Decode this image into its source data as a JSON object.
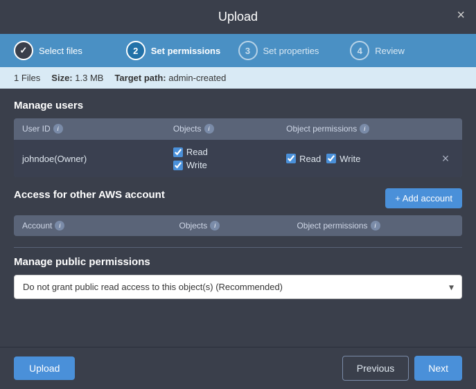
{
  "modal": {
    "title": "Upload",
    "close_label": "×"
  },
  "steps": [
    {
      "id": 1,
      "label": "Select files",
      "state": "completed",
      "icon": "✓"
    },
    {
      "id": 2,
      "label": "Set permissions",
      "state": "active"
    },
    {
      "id": 3,
      "label": "Set properties",
      "state": "inactive"
    },
    {
      "id": 4,
      "label": "Review",
      "state": "inactive"
    }
  ],
  "info_bar": {
    "files_label": "1 Files",
    "size_label": "Size:",
    "size_value": "1.3 MB",
    "target_label": "Target path:",
    "target_value": "admin-created"
  },
  "manage_users": {
    "title": "Manage users",
    "columns": {
      "user_id": "User ID",
      "objects": "Objects",
      "object_permissions": "Object permissions"
    },
    "rows": [
      {
        "user_id": "johndoe(Owner)",
        "objects": [
          "Read",
          "Write"
        ],
        "obj_permissions": [
          "Read",
          "Write"
        ]
      }
    ]
  },
  "aws_section": {
    "title": "Access for other AWS account",
    "add_btn": "+ Add account",
    "columns": {
      "account": "Account",
      "objects": "Objects",
      "object_permissions": "Object permissions"
    }
  },
  "public_permissions": {
    "title": "Manage public permissions",
    "dropdown_value": "Do not grant public read access to this object(s) (Recommended)"
  },
  "footer": {
    "upload_label": "Upload",
    "previous_label": "Previous",
    "next_label": "Next"
  }
}
